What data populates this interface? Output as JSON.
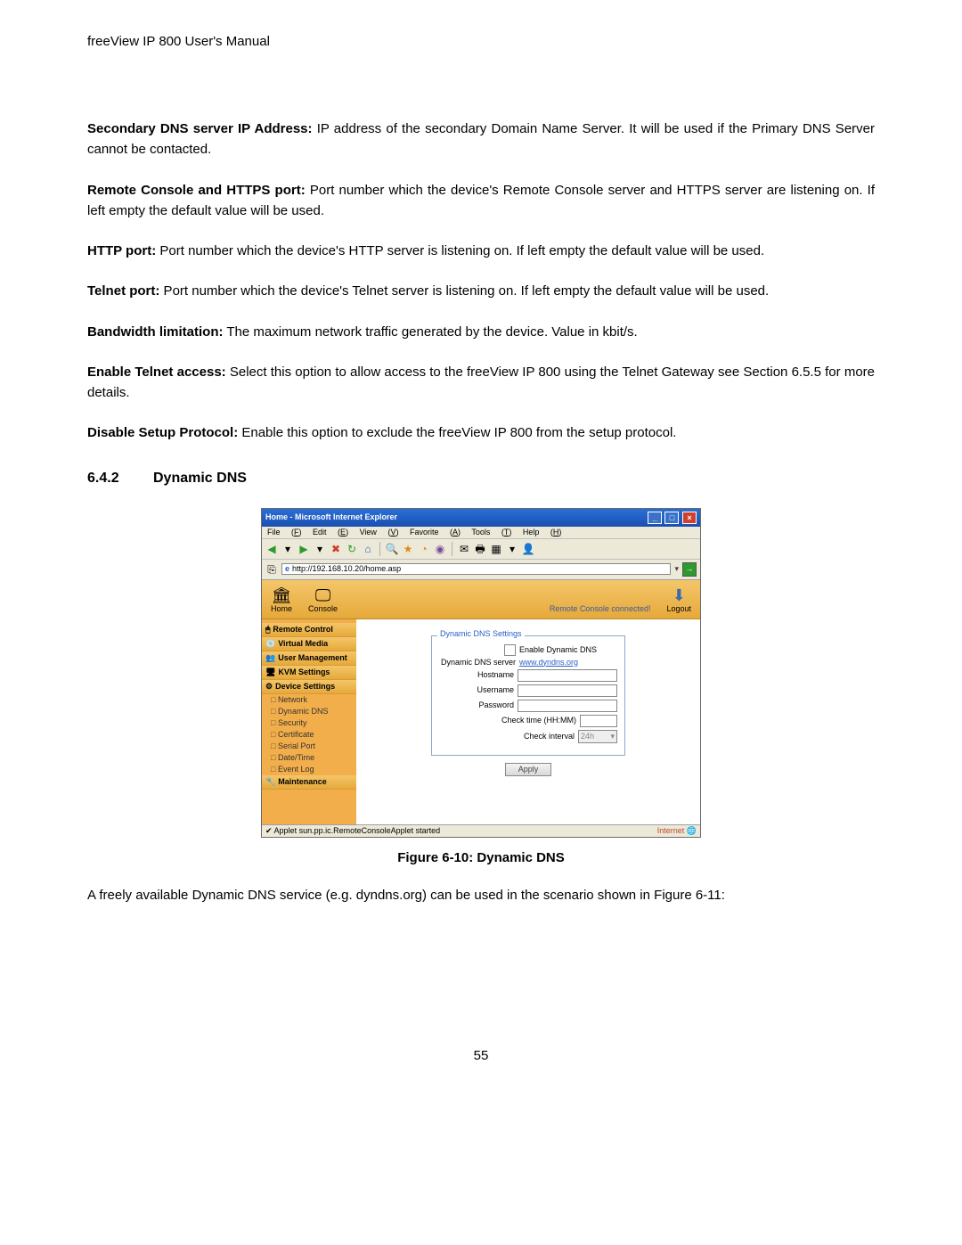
{
  "document": {
    "header": "freeView IP 800 User's Manual",
    "page_number": "55",
    "paragraphs": {
      "p1_bold": "Secondary DNS server IP Address:",
      "p1_rest": " IP address of the secondary Domain Name Server. It will be used if the Primary DNS Server cannot be contacted.",
      "p2_bold": "Remote Console and HTTPS port:",
      "p2_rest": " Port number which the device's Remote Console server and HTTPS server are listening on. If left empty the default value will be used.",
      "p3_bold": "HTTP port:",
      "p3_rest": " Port number which the device's HTTP server is listening on. If left empty the default value will be used.",
      "p4_bold": "Telnet port:",
      "p4_rest": " Port number which the device's Telnet server is listening on. If left empty the default value will be used.",
      "p5_bold": "Bandwidth limitation:",
      "p5_rest": " The maximum network traffic generated by the device. Value in kbit/s.",
      "p6_bold": "Enable Telnet access:",
      "p6_rest": " Select this option to allow access to the freeView IP 800 using the Telnet Gateway see Section 6.5.5 for more details.",
      "p7_bold": "Disable Setup Protocol:",
      "p7_rest": " Enable this option to exclude the freeView IP 800 from the setup protocol."
    },
    "section": {
      "number": "6.4.2",
      "title": "Dynamic DNS"
    },
    "figure_caption": "Figure 6-10: Dynamic DNS",
    "closing": "A freely available Dynamic DNS service (e.g. dyndns.org) can be used in the scenario shown in Figure 6-11:"
  },
  "screenshot": {
    "window_title": "Home - Microsoft Internet Explorer",
    "menus": {
      "file": "File",
      "edit": "Edit",
      "view": "View",
      "favorites": "Favorite",
      "tools": "Tools",
      "help": "Help"
    },
    "url": "http://192.168.10.20/home.asp",
    "banner": {
      "home": "Home",
      "console": "Console",
      "status": "Remote Console connected!",
      "logout": "Logout"
    },
    "sidebar": {
      "remote_control": "Remote Control",
      "virtual_media": "Virtual Media",
      "user_management": "User Management",
      "kvm_settings": "KVM Settings",
      "device_settings": "Device Settings",
      "subs": {
        "network": "Network",
        "dynamic_dns": "Dynamic DNS",
        "security": "Security",
        "certificate": "Certificate",
        "serial_port": "Serial Port",
        "date_time": "Date/Time",
        "event_log": "Event Log"
      },
      "maintenance": "Maintenance"
    },
    "form": {
      "legend": "Dynamic DNS Settings",
      "enable_label": "Enable Dynamic DNS",
      "server_label": "Dynamic DNS server",
      "server_link": "www.dyndns.org",
      "hostname": "Hostname",
      "username": "Username",
      "password": "Password",
      "check_time": "Check time (HH:MM)",
      "check_interval": "Check interval",
      "interval_value": "24h",
      "apply": "Apply"
    },
    "statusbar": {
      "left": "Applet sun.pp.ic.RemoteConsoleApplet started",
      "right": "Internet"
    }
  }
}
